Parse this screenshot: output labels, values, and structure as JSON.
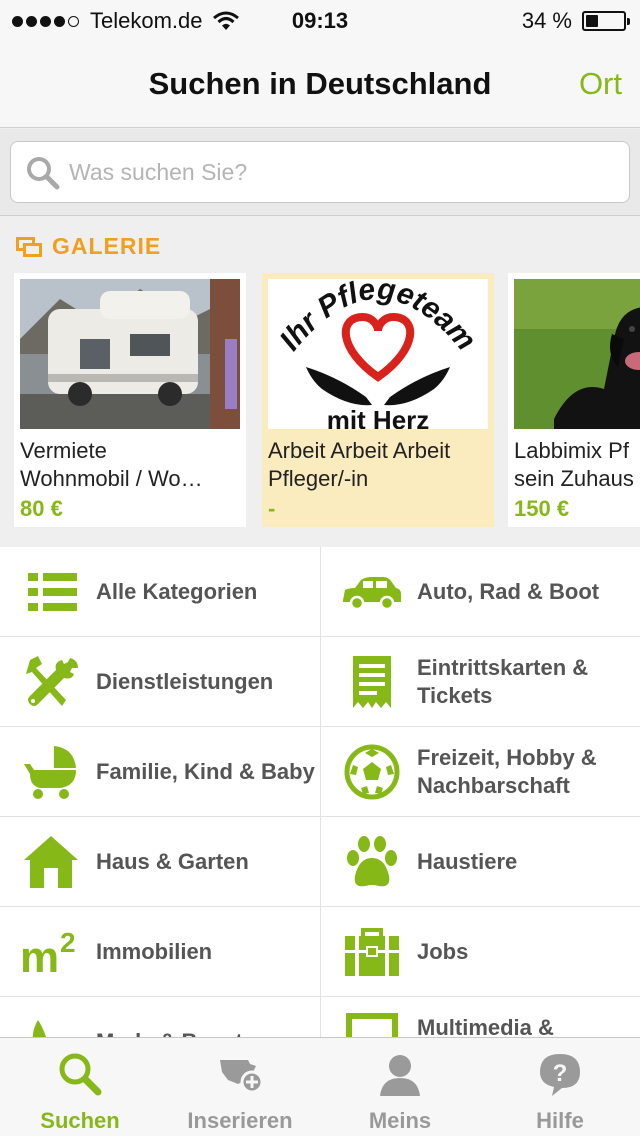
{
  "status_bar": {
    "carrier": "Telekom.de",
    "time": "09:13",
    "battery_text": "34 %",
    "battery_level": 0.34,
    "signal_bars": 4
  },
  "nav": {
    "title": "Suchen in Deutschland",
    "ort_label": "Ort"
  },
  "search": {
    "placeholder": "Was suchen Sie?",
    "value": ""
  },
  "gallery": {
    "title": "GALERIE",
    "items": [
      {
        "title_line1": "Vermiete",
        "title_line2": "Wohnmobil / Wo…",
        "price": "80 €",
        "highlighted": false,
        "image": "motorhome-photo"
      },
      {
        "title_line1": "Arbeit Arbeit Arbeit",
        "title_line2": "Pfleger/-in",
        "price": "-",
        "highlighted": true,
        "image": "pflegeteam-logo",
        "logo_text_top": "Ihr Pflegeteam",
        "logo_text_bottom": "mit Herz"
      },
      {
        "title_line1": "Labbimix Pf",
        "title_line2": "sein Zuhaus",
        "price": "150 €",
        "highlighted": false,
        "image": "black-dog-photo"
      }
    ]
  },
  "categories": [
    {
      "label": "Alle Kategorien",
      "icon": "list-icon"
    },
    {
      "label": "Auto, Rad & Boot",
      "icon": "car-icon"
    },
    {
      "label": "Dienstleistungen",
      "icon": "tools-icon"
    },
    {
      "label": "Eintrittskarten & Tickets",
      "icon": "ticket-icon"
    },
    {
      "label": "Familie, Kind & Baby",
      "icon": "stroller-icon"
    },
    {
      "label": "Freizeit, Hobby & Nachbarschaft",
      "icon": "soccer-ball-icon"
    },
    {
      "label": "Haus & Garten",
      "icon": "house-icon"
    },
    {
      "label": "Haustiere",
      "icon": "paw-icon"
    },
    {
      "label": "Immobilien",
      "icon": "square-meter-icon"
    },
    {
      "label": "Jobs",
      "icon": "briefcase-icon"
    },
    {
      "label": "Mode & Beauty",
      "icon": "fashion-icon"
    },
    {
      "label": "Multimedia & Elektronik",
      "icon": "monitor-icon"
    }
  ],
  "tabs": [
    {
      "label": "Suchen",
      "icon": "search-icon",
      "active": true
    },
    {
      "label": "Inserieren",
      "icon": "add-listing-icon",
      "active": false
    },
    {
      "label": "Meins",
      "icon": "person-icon",
      "active": false
    },
    {
      "label": "Hilfe",
      "icon": "help-bubble-icon",
      "active": false
    }
  ],
  "colors": {
    "accent_green": "#86b817",
    "gallery_orange": "#f0a020",
    "highlight_bg": "#fbecc0"
  }
}
